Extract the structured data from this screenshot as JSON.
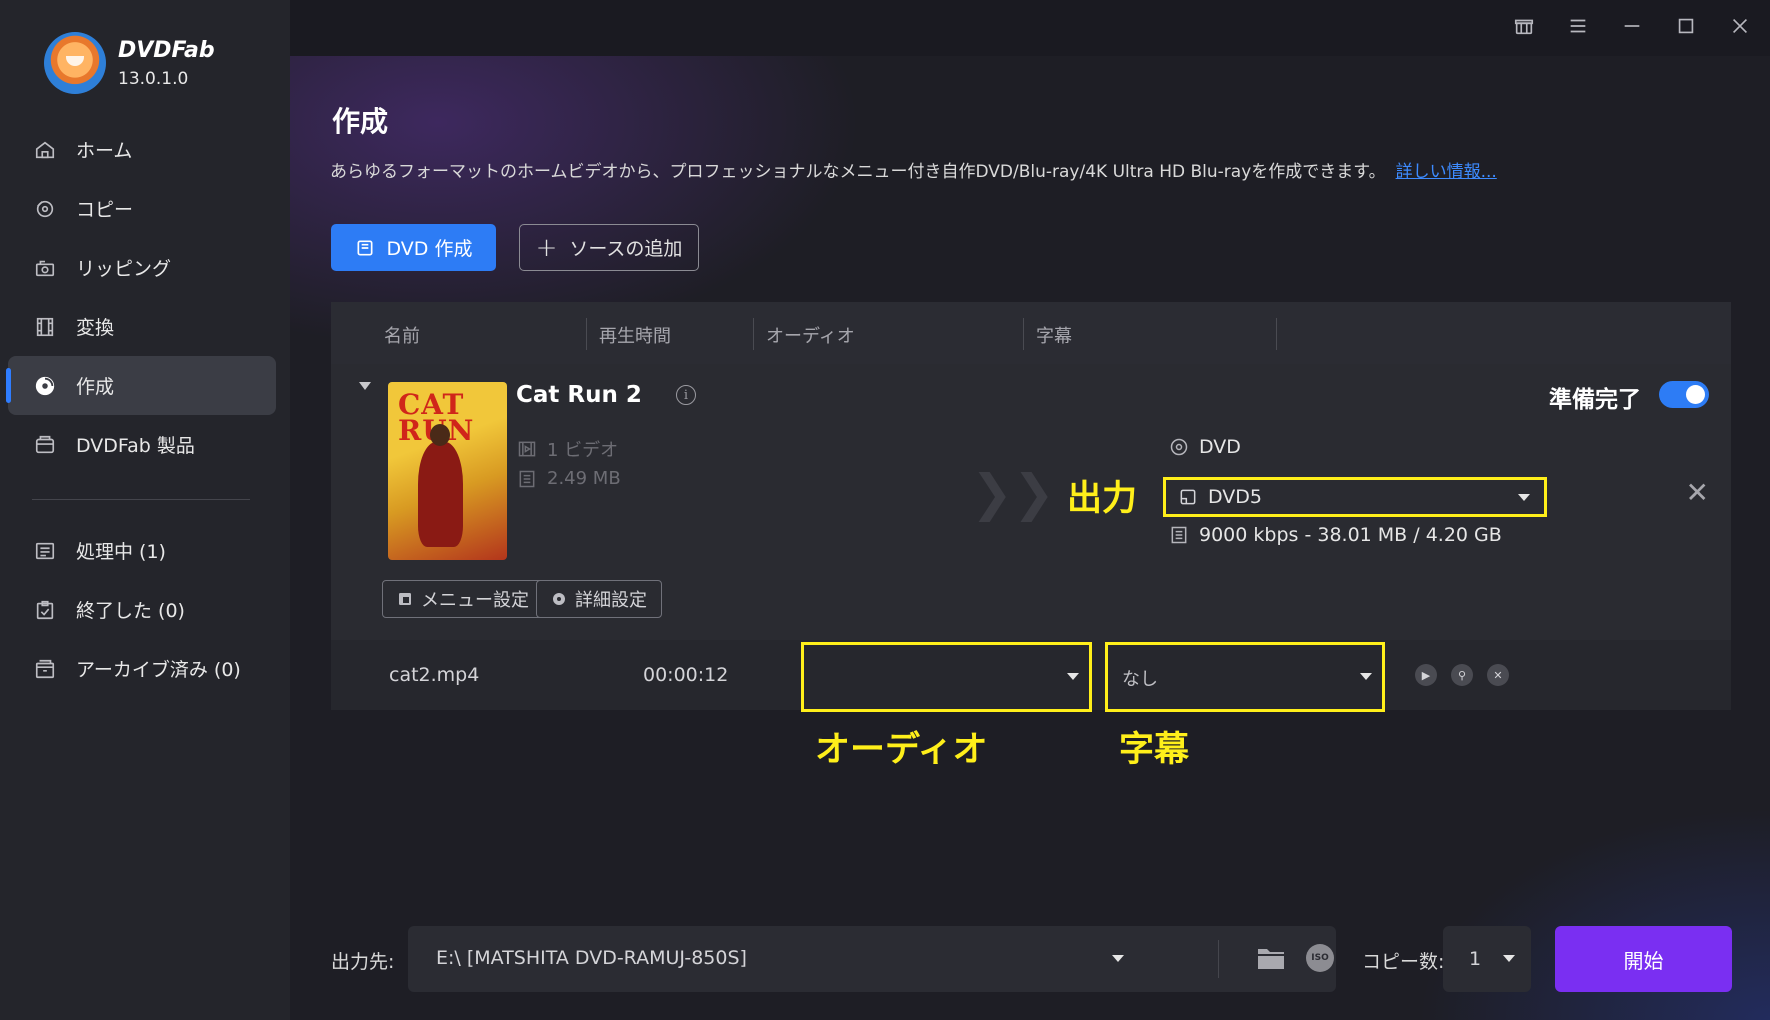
{
  "app": {
    "name": "DVDFab",
    "version": "13.0.1.0"
  },
  "sidebar": {
    "items": [
      {
        "label": "ホーム",
        "icon": "home-icon"
      },
      {
        "label": "コピー",
        "icon": "copy-icon"
      },
      {
        "label": "リッピング",
        "icon": "ripper-icon"
      },
      {
        "label": "変換",
        "icon": "film-icon"
      },
      {
        "label": "作成",
        "icon": "disc-icon",
        "active": true
      },
      {
        "label": "DVDFab 製品",
        "icon": "box-icon"
      }
    ],
    "queue": [
      {
        "label": "処理中 (1)",
        "icon": "list-icon"
      },
      {
        "label": "終了した (0)",
        "icon": "clipboard-icon"
      },
      {
        "label": "アーカイブ済み (0)",
        "icon": "archive-icon"
      }
    ]
  },
  "page": {
    "title": "作成",
    "description": "あらゆるフォーマットのホームビデオから、プロフェッショナルなメニュー付き自作DVD/Blu-ray/4K Ultra HD Blu-rayを作成できます。",
    "more_link": "詳しい情報..."
  },
  "toolbar": {
    "create_label": "DVD 作成",
    "add_source_label": "ソースの追加"
  },
  "table": {
    "headers": [
      "名前",
      "再生時間",
      "オーディオ",
      "字幕"
    ]
  },
  "item": {
    "poster_text": "CAT RUN",
    "title": "Cat Run 2",
    "videos": "1 ビデオ",
    "size": "2.49 MB",
    "ready_label": "準備完了",
    "ready_on": true,
    "output_type": "DVD",
    "output_format": "DVD5",
    "output_info": "9000 kbps - 38.01 MB / 4.20 GB",
    "menu_button": "メニュー設定",
    "advanced_button": "詳細設定"
  },
  "file": {
    "name": "cat2.mp4",
    "duration": "00:00:12",
    "audio_value": "",
    "subtitle_value": "なし"
  },
  "annotations": {
    "output": "出力",
    "audio": "オーディオ",
    "subtitle": "字幕",
    "color": "#ffef1a"
  },
  "footer": {
    "dest_label": "出力先:",
    "dest_value": "E:\\ [MATSHITA DVD-RAMUJ-850S]",
    "iso_label": "ISO",
    "copies_label": "コピー数:",
    "copies_value": "1",
    "start_label": "開始"
  },
  "colors": {
    "accent": "#2d7cf5",
    "start": "#7a2ff2",
    "highlight": "#ffef1a"
  }
}
